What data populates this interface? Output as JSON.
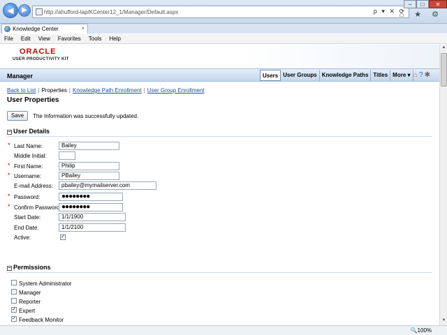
{
  "browser": {
    "url": "http://ahufford-lap/KCenter12_1/Manager/Default.aspx",
    "tab_title": "Knowledge Center",
    "tab_close": "×",
    "back_glyph": "◀",
    "forward_glyph": "▶",
    "addr_buttons": "ρ ▾ ✕ ⟳",
    "toolbar_icons": "⌂ ★ ⚙",
    "window_controls": [
      "–",
      "□",
      "✕"
    ],
    "zoom": "🔍100%",
    "menu": [
      "File",
      "Edit",
      "View",
      "Favorites",
      "Tools",
      "Help"
    ]
  },
  "brand": {
    "logo": "ORACLE",
    "subtitle": "USER PRODUCTIVITY KIT"
  },
  "appbar": {
    "title": "Manager",
    "nav": [
      "Users",
      "User Groups",
      "Knowledge Paths",
      "Titles",
      "More ▾"
    ],
    "active_nav": "Users",
    "icons": [
      "home-icon",
      "help-icon",
      "settings-icon"
    ],
    "icon_glyphs": {
      "home": "⌂",
      "help": "?",
      "settings": "✱"
    }
  },
  "subnav": {
    "back": "Back to List",
    "current": "Properties",
    "kp_enrollment": "Knowledge Path Enrollment",
    "ug_enrollment": "User Group Enrollment",
    "separator": "|"
  },
  "page": {
    "title": "User Properties",
    "save_label": "Save",
    "save_message": "The Information was successfully updated."
  },
  "user_details": {
    "heading": "User Details",
    "toggle": "−",
    "required_marker": "*",
    "last_name_label": "Last Name:",
    "last_name": "Bailey",
    "middle_initial_label": "Middle Initial:",
    "middle_initial": "",
    "first_name_label": "First Name:",
    "first_name": "Philip",
    "username_label": "Username:",
    "username": "PBailey",
    "email_label": "E-mail Address:",
    "email": "pbailey@mymailserver.com",
    "password_label": "Password:",
    "password": "●●●●●●●●",
    "confirm_password_label": "Confirm Password:",
    "confirm_password": "●●●●●●●●",
    "start_date_label": "Start Date:",
    "start_date": "1/1/1900",
    "end_date_label": "End Date:",
    "end_date": "1/1/2100",
    "active_label": "Active:",
    "active": "✓"
  },
  "permissions": {
    "heading": "Permissions",
    "toggle": "−",
    "check_glyph": "✓",
    "items": [
      {
        "label": "System Administrator",
        "checked": false
      },
      {
        "label": "Manager",
        "checked": false
      },
      {
        "label": "Reporter",
        "checked": false
      },
      {
        "label": "Expert",
        "checked": true
      },
      {
        "label": "Feedback Monitor",
        "checked": true
      }
    ]
  }
}
